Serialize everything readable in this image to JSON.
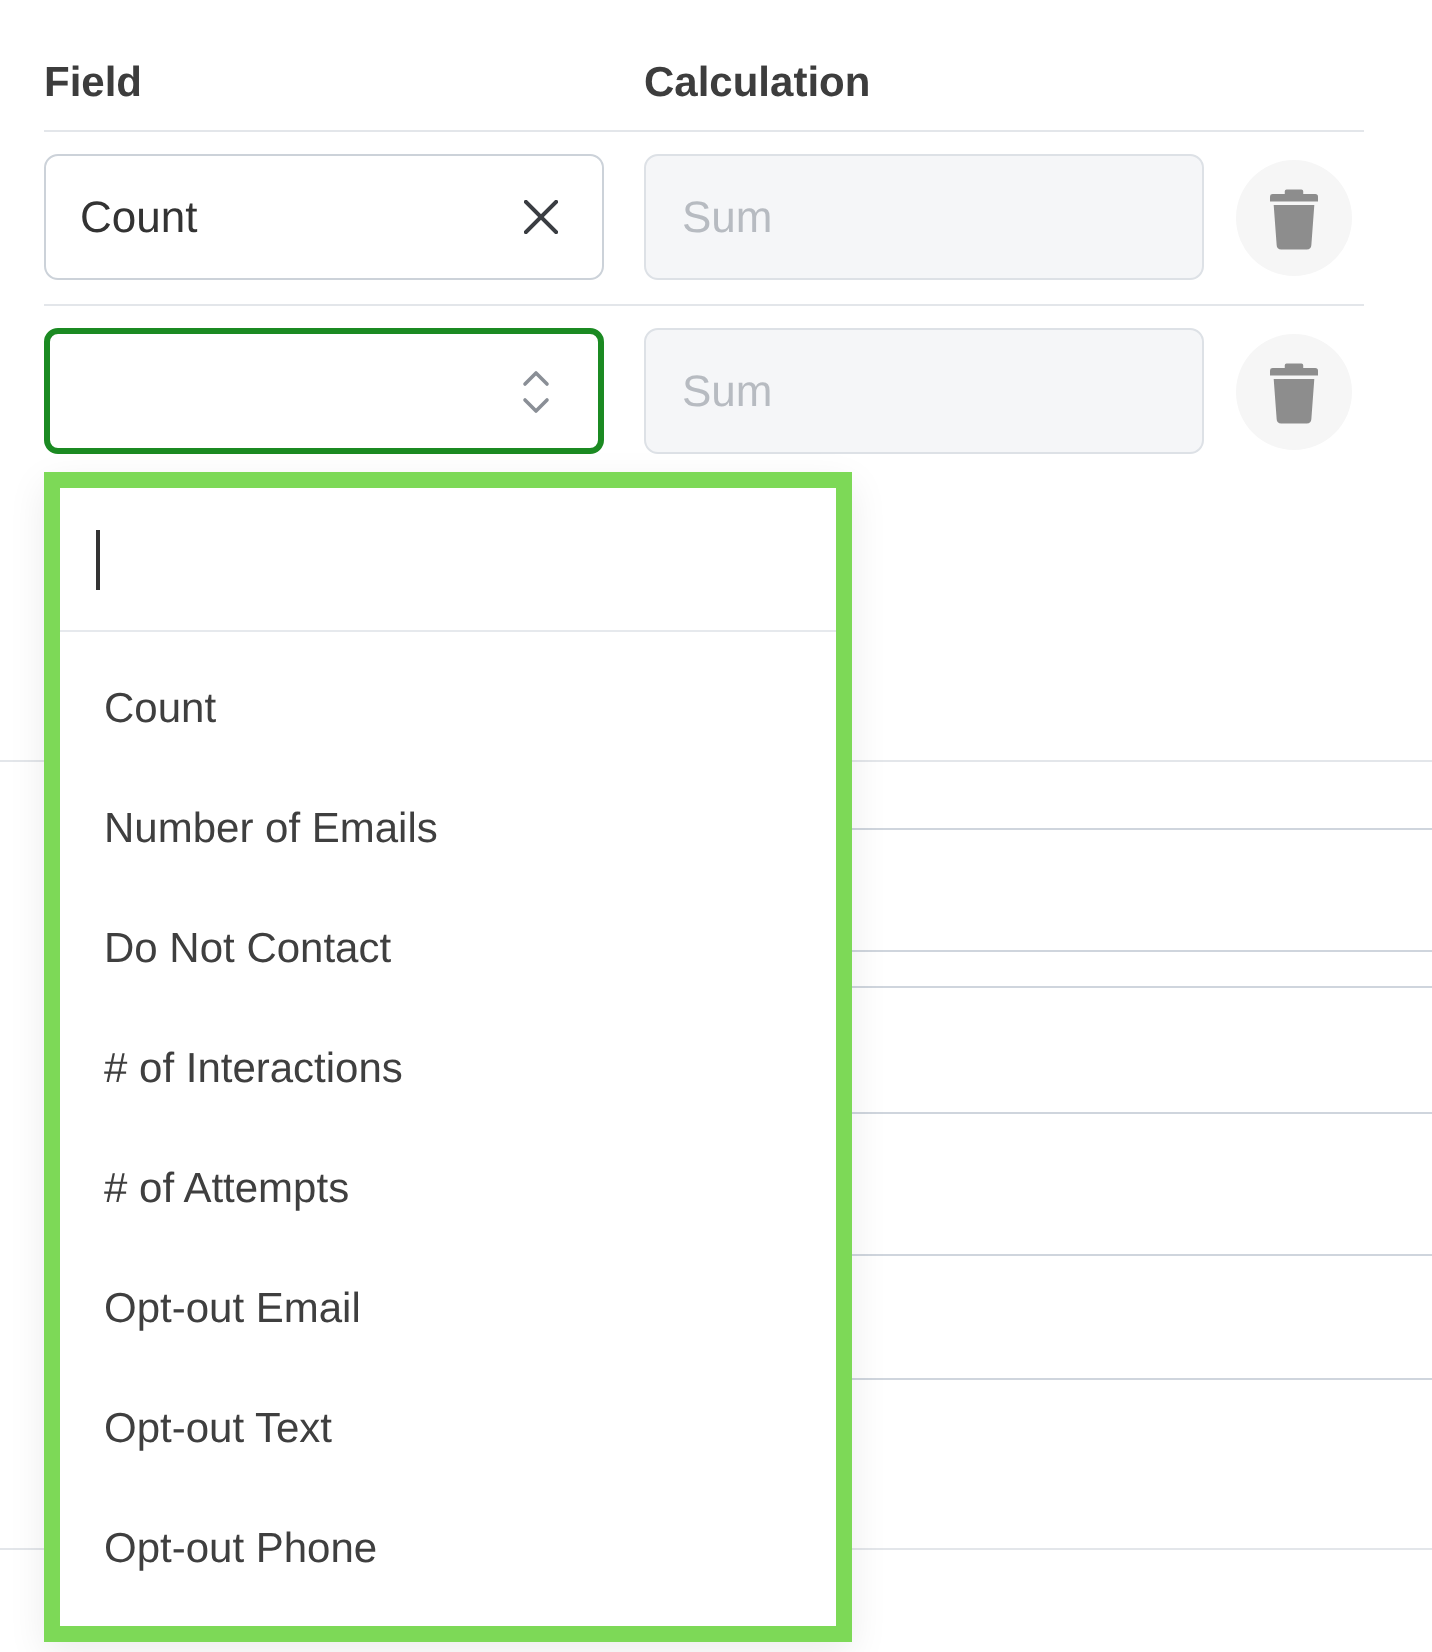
{
  "columns": [
    {
      "label": "Field"
    },
    {
      "label": "Calculation"
    }
  ],
  "rows": [
    {
      "field": {
        "value": "Count",
        "focused": false
      },
      "calculation": {
        "placeholder": "Sum",
        "disabled": true
      }
    },
    {
      "field": {
        "focused": true
      },
      "calculation": {
        "placeholder": "Sum",
        "disabled": true
      }
    }
  ],
  "dropdown": {
    "search": {
      "focused": true
    },
    "options": [
      {
        "label": "Count",
        "selected": false
      },
      {
        "label": "Number of Emails",
        "selected": false
      },
      {
        "label": "Do Not Contact",
        "selected": false
      },
      {
        "label": "# of Interactions",
        "selected": false
      },
      {
        "label": "# of Attempts",
        "selected": false
      },
      {
        "label": "Opt-out Email",
        "selected": false
      },
      {
        "label": "Opt-out Text",
        "selected": false
      },
      {
        "label": "Opt-out Phone",
        "selected": false
      }
    ]
  }
}
